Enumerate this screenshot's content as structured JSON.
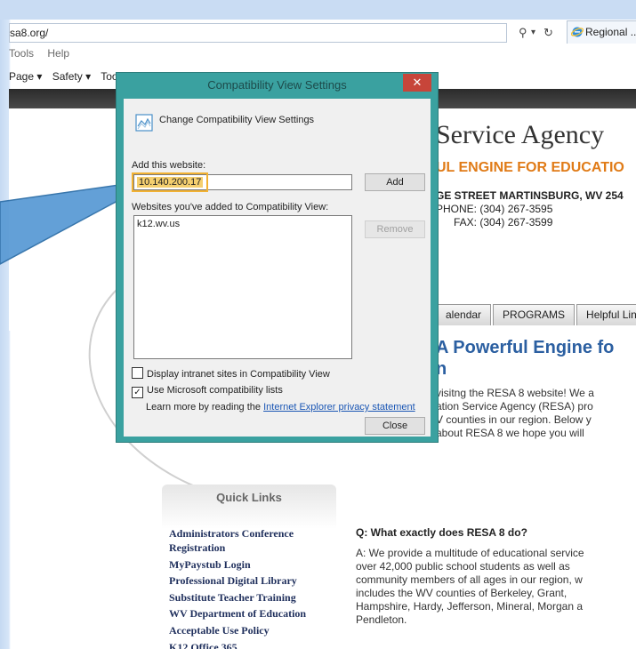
{
  "browser": {
    "address": "sa8.org/",
    "address_tools": {
      "search": "⚲",
      "dropdown": "▾",
      "refresh": "↻"
    },
    "tab_title": "Regional ...",
    "menu": [
      "Tools",
      "Help"
    ],
    "commands": [
      "Page ▾",
      "Safety ▾",
      "Too"
    ]
  },
  "site": {
    "title": "Service Agency",
    "tagline": "UL ENGINE FOR EDUCATIO",
    "address_line1": "GE STREET MARTINSBURG, WV 254",
    "address_line2": "PHONE: (304) 267-3595",
    "address_line3": "FAX: (304) 267-3599",
    "nav_tabs": [
      "alendar",
      "PROGRAMS",
      "Helpful Links"
    ],
    "headline": "A Powerful Engine fo",
    "headline_cont": "n",
    "intro_lines": [
      "visitng the RESA 8 website! We a",
      "ation Service Agency (RESA) pro",
      "V counties in our region. Below y",
      "about RESA 8 we hope you will"
    ],
    "quick_links_title": "Quick Links",
    "quick_links": [
      "Administrators Conference Registration",
      "MyPaystub Login",
      "Professional Digital Library",
      "Substitute Teacher Training",
      "WV Department of Education",
      "Acceptable Use Policy",
      "K12 Office 365"
    ],
    "question": "Q: What exactly does RESA 8 do?",
    "answer_lines": [
      "A: We provide a multitude of educational service",
      "over 42,000 public school students as well as",
      "community members of all ages in our region, w",
      "includes the WV counties of Berkeley, Grant,",
      "Hampshire, Hardy, Jefferson, Mineral, Morgan a",
      "Pendleton."
    ]
  },
  "dialog": {
    "title": "Compatibility View Settings",
    "close_x": "✕",
    "heading": "Change Compatibility View Settings",
    "add_label": "Add this website:",
    "add_value": "10.140.200.17",
    "add_button": "Add",
    "list_label": "Websites you've added to Compatibility View:",
    "list_items": [
      "k12.wv.us"
    ],
    "remove_button": "Remove",
    "check_intranet": "Display intranet sites in Compatibility View",
    "check_intranet_checked": false,
    "check_mslists": "Use Microsoft compatibility lists",
    "check_mslists_checked": true,
    "learn_prefix": "Learn more by reading the ",
    "learn_link": "Internet Explorer privacy statement",
    "close_button": "Close"
  },
  "colors": {
    "dialog_frame": "#3aa1a0",
    "close_red": "#c7453a",
    "highlight": "#f2b233",
    "callout_arrow": "#5b9bd5"
  }
}
